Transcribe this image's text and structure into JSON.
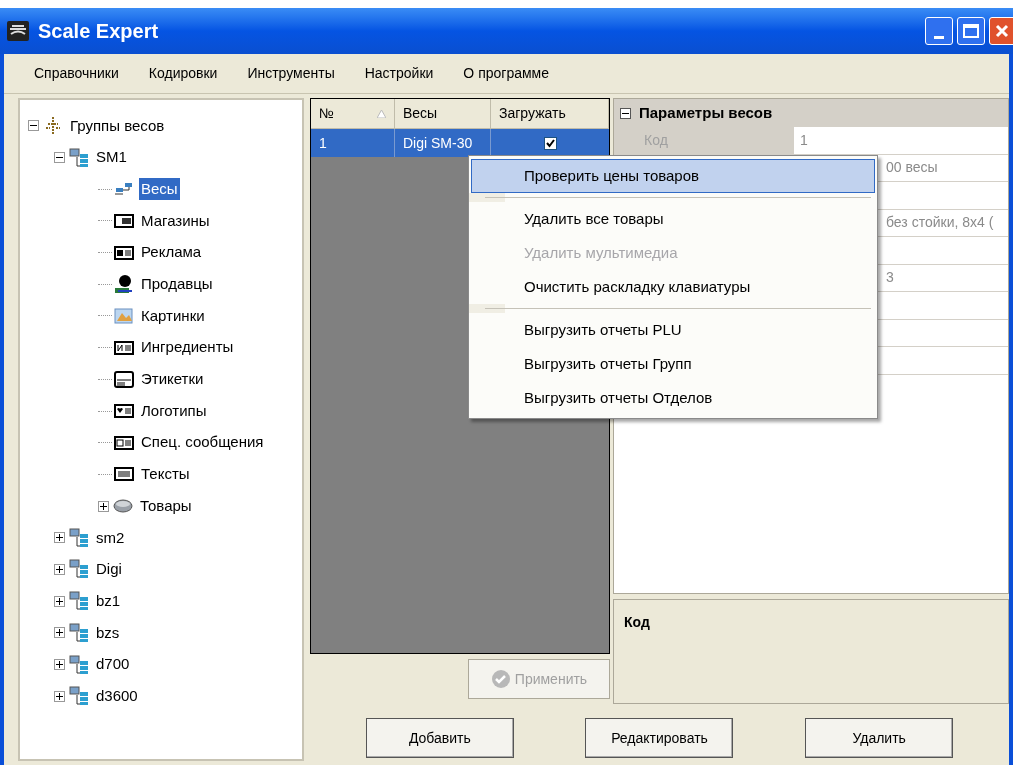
{
  "window": {
    "title": "Scale Expert"
  },
  "menu_bar": [
    "Справочники",
    "Кодировки",
    "Инструменты",
    "Настройки",
    "О программе"
  ],
  "tree": [
    {
      "label": "Группы весов",
      "kind": "root",
      "expanded": true,
      "selected": false,
      "children": [
        {
          "label": "SM1",
          "kind": "scale-group",
          "expanded": true,
          "selected": false,
          "children": [
            {
              "label": "Весы",
              "kind": "scales",
              "selected": true
            },
            {
              "label": "Магазины",
              "kind": "stores",
              "selected": false
            },
            {
              "label": "Реклама",
              "kind": "ads",
              "selected": false
            },
            {
              "label": "Продавцы",
              "kind": "sellers",
              "selected": false
            },
            {
              "label": "Картинки",
              "kind": "pictures",
              "selected": false
            },
            {
              "label": "Ингредиенты",
              "kind": "ingredients",
              "selected": false
            },
            {
              "label": "Этикетки",
              "kind": "labels",
              "selected": false
            },
            {
              "label": "Логотипы",
              "kind": "logos",
              "selected": false
            },
            {
              "label": "Спец. сообщения",
              "kind": "messages",
              "selected": false
            },
            {
              "label": "Тексты",
              "kind": "texts",
              "selected": false
            },
            {
              "label": "Товары",
              "kind": "goods",
              "expanded": false,
              "selected": false
            }
          ]
        },
        {
          "label": "sm2",
          "kind": "scale-group",
          "expanded": false,
          "selected": false
        },
        {
          "label": "Digi",
          "kind": "scale-group",
          "expanded": false,
          "selected": false
        },
        {
          "label": "bz1",
          "kind": "scale-group",
          "expanded": false,
          "selected": false
        },
        {
          "label": "bzs",
          "kind": "scale-group",
          "expanded": false,
          "selected": false
        },
        {
          "label": "d700",
          "kind": "scale-group",
          "expanded": false,
          "selected": false
        },
        {
          "label": "d3600",
          "kind": "scale-group",
          "expanded": false,
          "selected": false
        }
      ]
    }
  ],
  "grid": {
    "columns": [
      "№",
      "Весы",
      "Загружать"
    ],
    "rows": [
      {
        "number": "1",
        "scale": "Digi SM-30",
        "load": true,
        "selected": true
      }
    ]
  },
  "properties": {
    "category": "Параметры весов",
    "expanded": true,
    "rows": [
      {
        "label": "Код",
        "value": "1"
      },
      {
        "value": "00 весы"
      },
      {
        "value": ""
      },
      {
        "value": "без стойки, 8x4 ("
      },
      {
        "value": ""
      },
      {
        "value": "3"
      },
      {
        "value": ""
      },
      {
        "value": ""
      },
      {
        "value": ""
      }
    ]
  },
  "description": {
    "title": "Код"
  },
  "apply_button": {
    "label": "Применить",
    "disabled": true
  },
  "buttons": [
    "Добавить",
    "Редактировать",
    "Удалить"
  ],
  "context_menu": [
    {
      "kind": "item",
      "label": "Проверить цены товаров",
      "selected": true,
      "disabled": false
    },
    {
      "kind": "separator"
    },
    {
      "kind": "item",
      "label": "Удалить все товары",
      "selected": false,
      "disabled": false
    },
    {
      "kind": "item",
      "label": "Удалить мультимедиа",
      "selected": false,
      "disabled": true
    },
    {
      "kind": "item",
      "label": "Очистить раскладку клавиатуры",
      "selected": false,
      "disabled": false
    },
    {
      "kind": "separator"
    },
    {
      "kind": "item",
      "label": "Выгрузить отчеты PLU",
      "selected": false,
      "disabled": false
    },
    {
      "kind": "item",
      "label": "Выгрузить отчеты Групп",
      "selected": false,
      "disabled": false
    },
    {
      "kind": "item",
      "label": "Выгрузить отчеты Отделов",
      "selected": false,
      "disabled": false
    }
  ]
}
